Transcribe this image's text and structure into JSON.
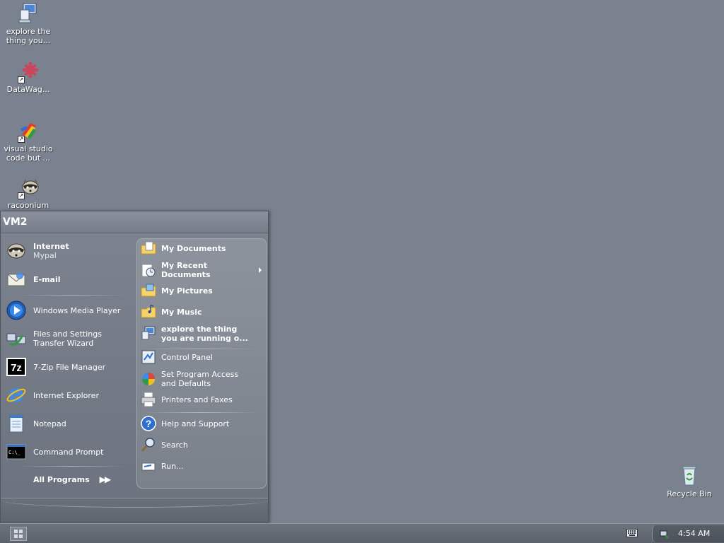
{
  "desktop": {
    "icons": [
      {
        "label": "explore the thing you...",
        "icon": "computer-icon"
      },
      {
        "label": "DataWag...",
        "icon": "datawag-icon"
      },
      {
        "label": "visual studio code but ...",
        "icon": "vscode-icon"
      },
      {
        "label": "racoonium",
        "icon": "raccoon-icon"
      },
      {
        "label": "Recycle Bin",
        "icon": "recycle-bin-icon"
      }
    ]
  },
  "start_menu": {
    "user": "VM2",
    "pinned": [
      {
        "title": "Internet",
        "subtitle": "Mypal",
        "icon": "raccoon-icon"
      },
      {
        "title": "E-mail",
        "subtitle": "",
        "icon": "email-icon"
      }
    ],
    "recent": [
      {
        "label": "Windows Media Player",
        "icon": "media-player-icon"
      },
      {
        "label": "Files and Settings Transfer Wizard",
        "line1": "Files and Settings",
        "line2": "Transfer Wizard",
        "icon": "transfer-wizard-icon"
      },
      {
        "label": "7-Zip File Manager",
        "icon": "7zip-icon"
      },
      {
        "label": "Internet Explorer",
        "icon": "ie-icon"
      },
      {
        "label": "Notepad",
        "icon": "notepad-icon"
      },
      {
        "label": "Command Prompt",
        "icon": "cmd-icon"
      }
    ],
    "all_programs": "All Programs",
    "places": [
      {
        "label": "My Documents",
        "icon": "folder-docs-icon"
      },
      {
        "label": "My Recent Documents",
        "line1": "My Recent",
        "line2": "Documents",
        "icon": "recent-docs-icon"
      },
      {
        "label": "My Pictures",
        "icon": "folder-pictures-icon"
      },
      {
        "label": "My Music",
        "icon": "folder-music-icon"
      },
      {
        "label": "explore the thing you are running o...",
        "line1": "explore the thing",
        "line2": "you are running o...",
        "icon": "computer-icon"
      }
    ],
    "system": [
      {
        "label": "Control Panel",
        "icon": "control-panel-icon"
      },
      {
        "label": "Set Program Access and Defaults",
        "line1": "Set Program Access",
        "line2": "and Defaults",
        "icon": "program-access-icon"
      },
      {
        "label": "Printers and Faxes",
        "icon": "printer-icon"
      }
    ],
    "help": [
      {
        "label": "Help and Support",
        "icon": "help-icon"
      },
      {
        "label": "Search",
        "icon": "search-icon"
      },
      {
        "label": "Run...",
        "icon": "run-icon"
      }
    ]
  },
  "taskbar": {
    "clock": "4:54 AM"
  }
}
